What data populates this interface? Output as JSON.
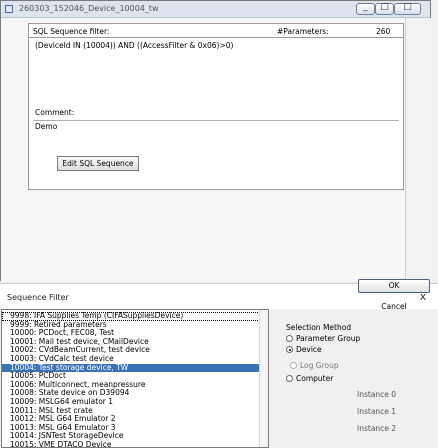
{
  "window": {
    "title": "260303_152046_Device_10004_tw",
    "buttons": [
      "minimize",
      "maximize",
      "close"
    ]
  },
  "sql_panel": {
    "filter_label": "SQL Sequence filter:",
    "parameters_label": "#Parameters:",
    "parameters_value": "260",
    "sql_text": "(DeviceId IN (10004)) AND ((AccessFilter & 0x06)>0)",
    "comment_label": "Comment:",
    "comment_value": "Demo",
    "edit_button": "Edit SQL Sequence"
  },
  "dialog": {
    "title": "Sequence Filter",
    "close_glyph": "x",
    "list_items": [
      {
        "text": "9998: IFA Supplies Temp (CIFASuppliesDevice)",
        "selected": false,
        "focused": true
      },
      {
        "text": "9999: Retired parameters",
        "selected": false
      },
      {
        "text": "10000: PCDoct, FEC08, Test",
        "selected": false
      },
      {
        "text": "10001: Mail test device, CMailDevice",
        "selected": false
      },
      {
        "text": "10002: CVdBeamCurrent, test device",
        "selected": false
      },
      {
        "text": "10003: CVdCalc test device",
        "selected": false
      },
      {
        "text": "10004: Test storage device, TW",
        "selected": true
      },
      {
        "text": "10005: PCDoct",
        "selected": false
      },
      {
        "text": "10006: Multiconnect, meanpressure",
        "selected": false
      },
      {
        "text": "10008: State device on D39094",
        "selected": false
      },
      {
        "text": "10009: MSLG64 emulator 1",
        "selected": false
      },
      {
        "text": "10011: MSL test crate",
        "selected": false
      },
      {
        "text": "10012: MSL G64 Emulator 2",
        "selected": false
      },
      {
        "text": "10013: MSL G64 Emulator 3",
        "selected": false
      },
      {
        "text": "10014: JSNTest StorageDevice",
        "selected": false
      },
      {
        "text": "10015: VME DTACQ Device",
        "selected": false
      }
    ],
    "ok_label": "OK",
    "cancel_label": "Cancel",
    "selection_method_label": "Selection Method",
    "radios": [
      {
        "label": "Parameter Group",
        "checked": false,
        "enabled": true
      },
      {
        "label": "Device",
        "checked": true,
        "enabled": true
      },
      {
        "label": "Log Group",
        "checked": false,
        "enabled": false
      },
      {
        "label": "Computer",
        "checked": false,
        "enabled": true
      }
    ],
    "instances": [
      "Instance 0",
      "Instance 1",
      "Instance 2"
    ]
  }
}
